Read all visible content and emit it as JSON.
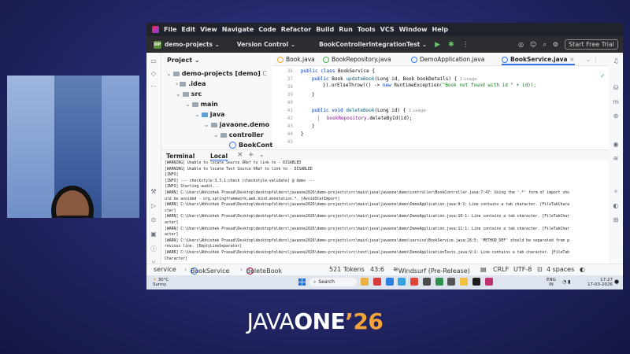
{
  "menu": [
    "File",
    "Edit",
    "View",
    "Navigate",
    "Code",
    "Refactor",
    "Build",
    "Run",
    "Tools",
    "VCS",
    "Window",
    "Help"
  ],
  "toolbar": {
    "project_badge": "DP",
    "project": "demo-projects",
    "vcs": "Version Control",
    "run_config": "BookControllerIntegrationTest",
    "trial": "Start Free Trial"
  },
  "project_pane": {
    "header": "Project",
    "items": [
      "demo-projects [demo]",
      ".idea",
      "src",
      "main",
      "java",
      "javaone.demo",
      "controller",
      "BookControl"
    ],
    "root_suffix": "C"
  },
  "tabs": [
    "Book.java",
    "BookRepository.java",
    "DemoApplication.java",
    "BookService.java"
  ],
  "editor": {
    "line_numbers": [
      "36",
      "37",
      "38",
      "39",
      "40",
      "41",
      "42",
      "43",
      "44",
      "45"
    ],
    "lines": [
      {
        "a": "public class ",
        "b": "BookService",
        "c": " {"
      },
      {
        "a": "public ",
        "b": "Book ",
        "c": "updateBook",
        "d": "(Long id, Book bookDetails) {",
        "hint": "1 usage"
      },
      {
        "a": "}).orElseThrow(() -> ",
        "b": "new ",
        "c": "RuntimeException",
        "d": "(\"Book not found with id \" + id));"
      },
      {
        "a": "}"
      },
      {
        "a": "public void ",
        "b": "deleteBook",
        "c": "(Long id) {",
        "hint": "1 usage"
      },
      {
        "a": "bookRepository",
        "b": ".deleteById(id);"
      },
      {
        "a": "}"
      },
      {
        "a": "}"
      }
    ]
  },
  "terminal": {
    "tab_terminal": "Terminal",
    "tab_local": "Local",
    "lines": [
      "[WARNING] Unable to locate Source XRef to link to - DISABLED",
      "[WARNING] Unable to locate Test Source XRef to link to - DISABLED",
      "[INFO]",
      "[INFO] --- checkstyle:3.3.1:check (checkstyle-validate) @ demo ---",
      "[INFO] Starting audit...",
      "[WARN] C:\\Users\\Abhishek Prasad\\Desktop\\desktopfolders\\javaone2026\\demo-projects\\src\\main\\java\\javaone\\demo\\controller\\BookController.java:7:47: Using the '.*' form of import sho",
      "uld be avoided - org.springframework.web.bind.annotation.*. [AvoidStarImport]",
      "[WARN] C:\\Users\\Abhishek Prasad\\Desktop\\desktopfolders\\javaone2026\\demo-projects\\src\\main\\java\\javaone\\demo\\DemoApplication.java:9:1: Line contains a tab character. [FileTabChara",
      "cter]",
      "[WARN] C:\\Users\\Abhishek Prasad\\Desktop\\desktopfolders\\javaone2026\\demo-projects\\src\\main\\java\\javaone\\demo\\DemoApplication.java:10:1: Line contains a tab character. [FileTabChar",
      "acter]",
      "[WARN] C:\\Users\\Abhishek Prasad\\Desktop\\desktopfolders\\javaone2026\\demo-projects\\src\\main\\java\\javaone\\demo\\DemoApplication.java:11:1: Line contains a tab character. [FileTabChar",
      "acter]",
      "[WARN] C:\\Users\\Abhishek Prasad\\Desktop\\desktopfolders\\javaone2026\\demo-projects\\src\\main\\java\\javaone\\demo\\service\\BookService.java:28:5: 'METHOD_DEF' should be separated from p",
      "revious line. [EmptyLineSeparator]",
      "[WARN] C:\\Users\\Abhishek Prasad\\Desktop\\desktopfolders\\javaone2026\\demo-projects\\src\\test\\java\\javaone\\demo\\DemoApplicationTests.java:9:1: Line contains a tab character. [FileTab",
      "Character]"
    ]
  },
  "status": {
    "crumb1": "service",
    "crumb2": "BookService",
    "crumb3": "deleteBook",
    "tokens": "521 Tokens",
    "position": "43:6",
    "windsurf": "Windsurf (Pre-Release)",
    "line_sep": "CRLF",
    "encoding": "UTF-8",
    "indent": "4 spaces"
  },
  "taskbar": {
    "temp": "30°C",
    "weather": "Sunny",
    "search": "Search",
    "lang1": "ENG",
    "lang2": "IN",
    "time": "17:27",
    "date": "17-03-2026"
  },
  "brand": {
    "a": "JAVA",
    "b": "ONE",
    "c": "’26"
  }
}
